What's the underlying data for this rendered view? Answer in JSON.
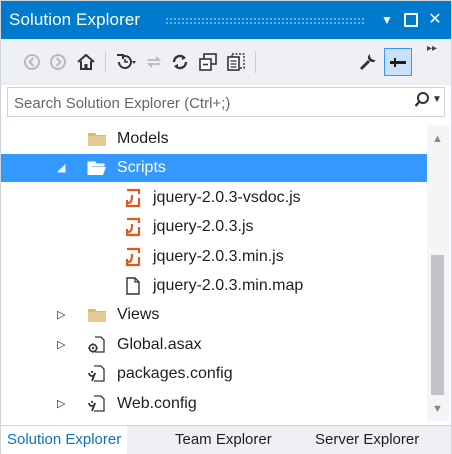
{
  "window": {
    "title": "Solution Explorer",
    "dropdown_icon": "chevron-down-icon",
    "maximize_icon": "maximize-icon",
    "close_glyph": "✕"
  },
  "toolbar": {
    "buttons": [
      {
        "name": "back-icon",
        "glyph": "◀"
      },
      {
        "name": "forward-icon",
        "glyph": "▶"
      },
      {
        "name": "home-icon",
        "glyph": "⌂"
      },
      {
        "name": "pending-changes-filter-icon",
        "glyph": "⏲"
      },
      {
        "name": "sync-with-active-document-icon",
        "glyph": "⇄"
      },
      {
        "name": "refresh-icon",
        "glyph": "↻"
      },
      {
        "name": "collapse-all-icon",
        "glyph": "▤"
      },
      {
        "name": "show-all-files-icon",
        "glyph": "▦"
      },
      {
        "name": "properties-icon",
        "glyph": "🔧"
      },
      {
        "name": "pin-icon",
        "glyph": "━"
      }
    ],
    "overflow_glyph": "▸▸"
  },
  "search": {
    "placeholder": "Search Solution Explorer (Ctrl+;)",
    "value": ""
  },
  "tree": {
    "items": [
      {
        "label": "Models",
        "icon": "folder-icon",
        "expander": "",
        "indent": 1,
        "selected": false
      },
      {
        "label": "Scripts",
        "icon": "folder-open-icon",
        "expander": "◢",
        "indent": 1,
        "selected": true
      },
      {
        "label": "jquery-2.0.3-vsdoc.js",
        "icon": "javascript-file-icon",
        "expander": "",
        "indent": 2,
        "selected": false
      },
      {
        "label": "jquery-2.0.3.js",
        "icon": "javascript-file-icon",
        "expander": "",
        "indent": 2,
        "selected": false
      },
      {
        "label": "jquery-2.0.3.min.js",
        "icon": "javascript-file-icon",
        "expander": "",
        "indent": 2,
        "selected": false
      },
      {
        "label": "jquery-2.0.3.min.map",
        "icon": "file-icon",
        "expander": "",
        "indent": 2,
        "selected": false
      },
      {
        "label": "Views",
        "icon": "folder-icon",
        "expander": "▷",
        "indent": 1,
        "selected": false
      },
      {
        "label": "Global.asax",
        "icon": "global-asax-icon",
        "expander": "▷",
        "indent": 1,
        "selected": false
      },
      {
        "label": "packages.config",
        "icon": "config-file-icon",
        "expander": "",
        "indent": 1,
        "selected": false
      },
      {
        "label": "Web.config",
        "icon": "config-file-icon",
        "expander": "▷",
        "indent": 1,
        "selected": false
      }
    ]
  },
  "tabs": [
    {
      "label": "Solution Explorer",
      "active": true
    },
    {
      "label": "Team Explorer",
      "active": false
    },
    {
      "label": "Server Explorer",
      "active": false
    }
  ],
  "colors": {
    "title_bar": "#007acc",
    "selection": "#3399ff",
    "folder": "#dcb67a",
    "js_file": "#e05a1f",
    "active_tab_text": "#0e70c0"
  }
}
